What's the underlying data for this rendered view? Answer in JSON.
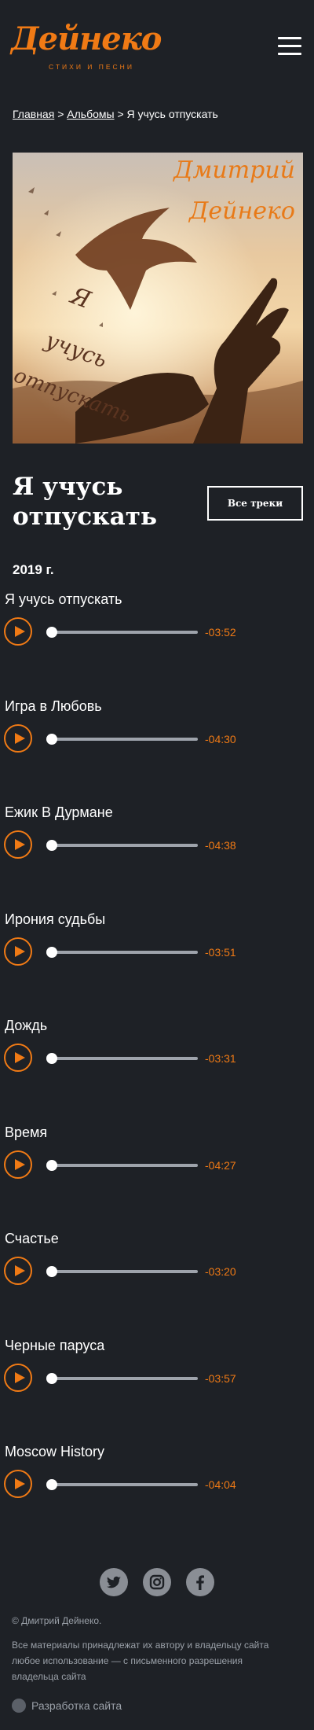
{
  "site": {
    "logo_text": "Дейнеко",
    "logo_subtitle": "СТИХИ И ПЕСНИ",
    "menu_icon": "hamburger-menu-icon",
    "accent_color": "#f07a15"
  },
  "breadcrumb": {
    "home": "Главная",
    "sep1": ">",
    "albums": "Альбомы",
    "sep2": ">",
    "current": "Я учусь отпускать"
  },
  "cover": {
    "artist_line1": "Дмитрий",
    "artist_line2": "Дейнеко",
    "album_word1": "Я",
    "album_word2": "учусь",
    "album_word3": "отпускать"
  },
  "album": {
    "title": "Я учусь отпускать",
    "all_tracks_label": "Все треки",
    "year": "2019 г."
  },
  "tracks": [
    {
      "title": "Я учусь отпускать",
      "time": "-03:52",
      "progress": 0
    },
    {
      "title": "Игра в Любовь",
      "time": "-04:30",
      "progress": 0
    },
    {
      "title": "Ежик В Дурмане",
      "time": "-04:38",
      "progress": 0
    },
    {
      "title": "Ирония судьбы",
      "time": "-03:51",
      "progress": 0
    },
    {
      "title": "Дождь",
      "time": "-03:31",
      "progress": 0
    },
    {
      "title": "Время",
      "time": "-04:27",
      "progress": 0
    },
    {
      "title": "Счастье",
      "time": "-03:20",
      "progress": 0
    },
    {
      "title": "Черные паруса",
      "time": "-03:57",
      "progress": 0
    },
    {
      "title": "Moscow History",
      "time": "-04:04",
      "progress": 0
    }
  ],
  "footer": {
    "social_icons": [
      "twitter-icon",
      "instagram-icon",
      "facebook-icon"
    ],
    "copyright": "© Дмитрий Дейнеко.",
    "rights_line1": "Все материалы принадлежат их автору и владельцу сайта",
    "rights_line2": "любое использование — с письменного разрешения",
    "rights_line3": "владельца сайта",
    "dev_label": "Разработка сайта"
  }
}
